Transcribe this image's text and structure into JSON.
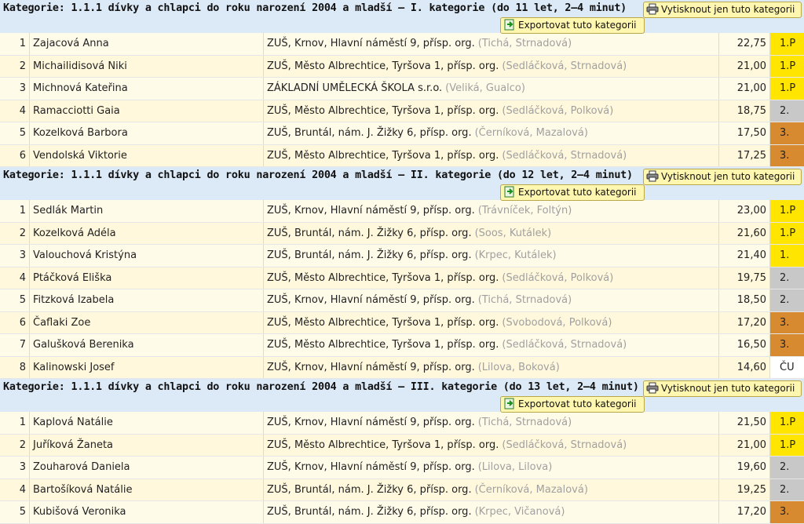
{
  "colors": {
    "first": "#ffe500",
    "second": "#c8c8c8",
    "third": "#d88a30",
    "header": "#dce9f7"
  },
  "categories": [
    {
      "title": "Kategorie: 1.1.1 dívky a chlapci do roku narození 2004 a mladší – I. kategorie (do 11 let, 2–4 minut)",
      "print_label": "Vytisknout jen tuto kategorii",
      "export_label": "Exportovat tuto kategorii",
      "rows": [
        {
          "num": "1",
          "name": "Zajacová Anna",
          "school": "ZUŠ, Krnov, Hlavní náměstí 9, přísp. org.",
          "teachers": "(Tichá, Strnadová)",
          "score": "22,75",
          "place": "1.P",
          "rank": "p1"
        },
        {
          "num": "2",
          "name": "Michailidisová Niki",
          "school": "ZUŠ, Město Albrechtice, Tyršova 1, přísp. org.",
          "teachers": "(Sedláčková, Strnadová)",
          "score": "21,00",
          "place": "1.P",
          "rank": "p1"
        },
        {
          "num": "3",
          "name": "Michnová Kateřina",
          "school": "ZÁKLADNÍ UMĚLECKÁ ŠKOLA s.r.o.",
          "teachers": "(Veliká, Gualco)",
          "score": "21,00",
          "place": "1.P",
          "rank": "p1"
        },
        {
          "num": "4",
          "name": "Ramacciotti Gaia",
          "school": "ZUŠ, Město Albrechtice, Tyršova 1, přísp. org.",
          "teachers": "(Sedláčková, Polková)",
          "score": "18,75",
          "place": "2.",
          "rank": "p2"
        },
        {
          "num": "5",
          "name": "Kozelková Barbora",
          "school": "ZUŠ, Bruntál, nám. J. Žižky 6, přísp. org.",
          "teachers": "(Černíková, Mazalová)",
          "score": "17,50",
          "place": "3.",
          "rank": "p3"
        },
        {
          "num": "6",
          "name": "Vendolská Viktorie",
          "school": "ZUŠ, Město Albrechtice, Tyršova 1, přísp. org.",
          "teachers": "(Sedláčková, Strnadová)",
          "score": "17,25",
          "place": "3.",
          "rank": "p3"
        }
      ]
    },
    {
      "title": "Kategorie: 1.1.1 dívky a chlapci do roku narození 2004 a mladší – II. kategorie (do 12 let, 2–4 minut)",
      "print_label": "Vytisknout jen tuto kategorii",
      "export_label": "Exportovat tuto kategorii",
      "rows": [
        {
          "num": "1",
          "name": "Sedlák Martin",
          "school": "ZUŠ, Krnov, Hlavní náměstí 9, přísp. org.",
          "teachers": "(Trávníček, Foltýn)",
          "score": "23,00",
          "place": "1.P",
          "rank": "p1"
        },
        {
          "num": "2",
          "name": "Kozelková Adéla",
          "school": "ZUŠ, Bruntál, nám. J. Žižky 6, přísp. org.",
          "teachers": "(Soos, Kutálek)",
          "score": "21,60",
          "place": "1.P",
          "rank": "p1"
        },
        {
          "num": "3",
          "name": "Valouchová Kristýna",
          "school": "ZUŠ, Bruntál, nám. J. Žižky 6, přísp. org.",
          "teachers": "(Krpec, Kutálek)",
          "score": "21,40",
          "place": "1.",
          "rank": "p1"
        },
        {
          "num": "4",
          "name": "Ptáčková Eliška",
          "school": "ZUŠ, Město Albrechtice, Tyršova 1, přísp. org.",
          "teachers": "(Sedláčková, Polková)",
          "score": "19,75",
          "place": "2.",
          "rank": "p2"
        },
        {
          "num": "5",
          "name": "Fitzková Izabela",
          "school": "ZUŠ, Krnov, Hlavní náměstí 9, přísp. org.",
          "teachers": "(Tichá, Strnadová)",
          "score": "18,50",
          "place": "2.",
          "rank": "p2"
        },
        {
          "num": "6",
          "name": "Čaflaki Zoe",
          "school": "ZUŠ, Město Albrechtice, Tyršova 1, přísp. org.",
          "teachers": "(Svobodová, Polková)",
          "score": "17,20",
          "place": "3.",
          "rank": "p3"
        },
        {
          "num": "7",
          "name": "Galušková Berenika",
          "school": "ZUŠ, Město Albrechtice, Tyršova 1, přísp. org.",
          "teachers": "(Sedláčková, Strnadová)",
          "score": "16,50",
          "place": "3.",
          "rank": "p3"
        },
        {
          "num": "8",
          "name": "Kalinowski Josef",
          "school": "ZUŠ, Krnov, Hlavní náměstí 9, přísp. org.",
          "teachers": "(Lilova, Boková)",
          "score": "14,60",
          "place": "ČU",
          "rank": "pc"
        }
      ]
    },
    {
      "title": "Kategorie: 1.1.1 dívky a chlapci do roku narození 2004 a mladší – III. kategorie (do 13 let, 2–4 minut)",
      "print_label": "Vytisknout jen tuto kategorii",
      "export_label": "Exportovat tuto kategorii",
      "rows": [
        {
          "num": "1",
          "name": "Kaplová Natálie",
          "school": "ZUŠ, Krnov, Hlavní náměstí 9, přísp. org.",
          "teachers": "(Tichá, Strnadová)",
          "score": "21,50",
          "place": "1.P",
          "rank": "p1"
        },
        {
          "num": "2",
          "name": "Juříková Žaneta",
          "school": "ZUŠ, Město Albrechtice, Tyršova 1, přísp. org.",
          "teachers": "(Sedláčková, Strnadová)",
          "score": "21,00",
          "place": "1.P",
          "rank": "p1"
        },
        {
          "num": "3",
          "name": "Zouharová Daniela",
          "school": "ZUŠ, Krnov, Hlavní náměstí 9, přísp. org.",
          "teachers": "(Lilova, Lilova)",
          "score": "19,60",
          "place": "2.",
          "rank": "p2"
        },
        {
          "num": "4",
          "name": "Bartošíková Natálie",
          "school": "ZUŠ, Bruntál, nám. J. Žižky 6, přísp. org.",
          "teachers": "(Černíková, Mazalová)",
          "score": "19,25",
          "place": "2.",
          "rank": "p2"
        },
        {
          "num": "5",
          "name": "Kubišová Veronika",
          "school": "ZUŠ, Bruntál, nám. J. Žižky 6, přísp. org.",
          "teachers": "(Krpec, Vičanová)",
          "score": "17,20",
          "place": "3.",
          "rank": "p3"
        }
      ]
    }
  ]
}
